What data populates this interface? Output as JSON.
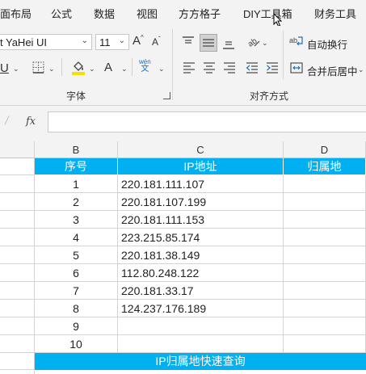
{
  "menu": {
    "tabs": [
      "面布局",
      "公式",
      "数据",
      "视图",
      "方方格子",
      "DIY工具箱",
      "财务工具"
    ]
  },
  "ribbon": {
    "font_name": "t YaHei UI",
    "font_size": "11",
    "font_group_label": "字体",
    "align_group_label": "对齐方式",
    "wrap_text_label": "自动换行",
    "merge_center_label": "合并后居中",
    "grow_font_glyph": "A",
    "shrink_font_glyph": "A",
    "underline_glyph": "U",
    "font_color_glyph": "A",
    "phonetic_top": "wén",
    "phonetic_bottom": "文",
    "fill_color": "#f5e100",
    "font_color": "#e02020"
  },
  "formula_bar": {
    "fx_label": "fx",
    "value": ""
  },
  "sheet": {
    "columns": [
      "B",
      "C",
      "D"
    ],
    "table_headers": [
      "序号",
      "IP地址",
      "归属地"
    ],
    "rows": [
      {
        "index": "1",
        "ip": "220.181.111.107",
        "location": ""
      },
      {
        "index": "2",
        "ip": "220.181.107.199",
        "location": ""
      },
      {
        "index": "3",
        "ip": "220.181.111.153",
        "location": ""
      },
      {
        "index": "4",
        "ip": "223.215.85.174",
        "location": ""
      },
      {
        "index": "5",
        "ip": "220.181.38.149",
        "location": ""
      },
      {
        "index": "6",
        "ip": "112.80.248.122",
        "location": ""
      },
      {
        "index": "7",
        "ip": "220.181.33.17",
        "location": ""
      },
      {
        "index": "8",
        "ip": "124.237.176.189",
        "location": ""
      },
      {
        "index": "9",
        "ip": "",
        "location": ""
      },
      {
        "index": "10",
        "ip": "",
        "location": ""
      }
    ],
    "footer_title": "IP归属地快速查询",
    "header_color": "#00b0f0"
  }
}
